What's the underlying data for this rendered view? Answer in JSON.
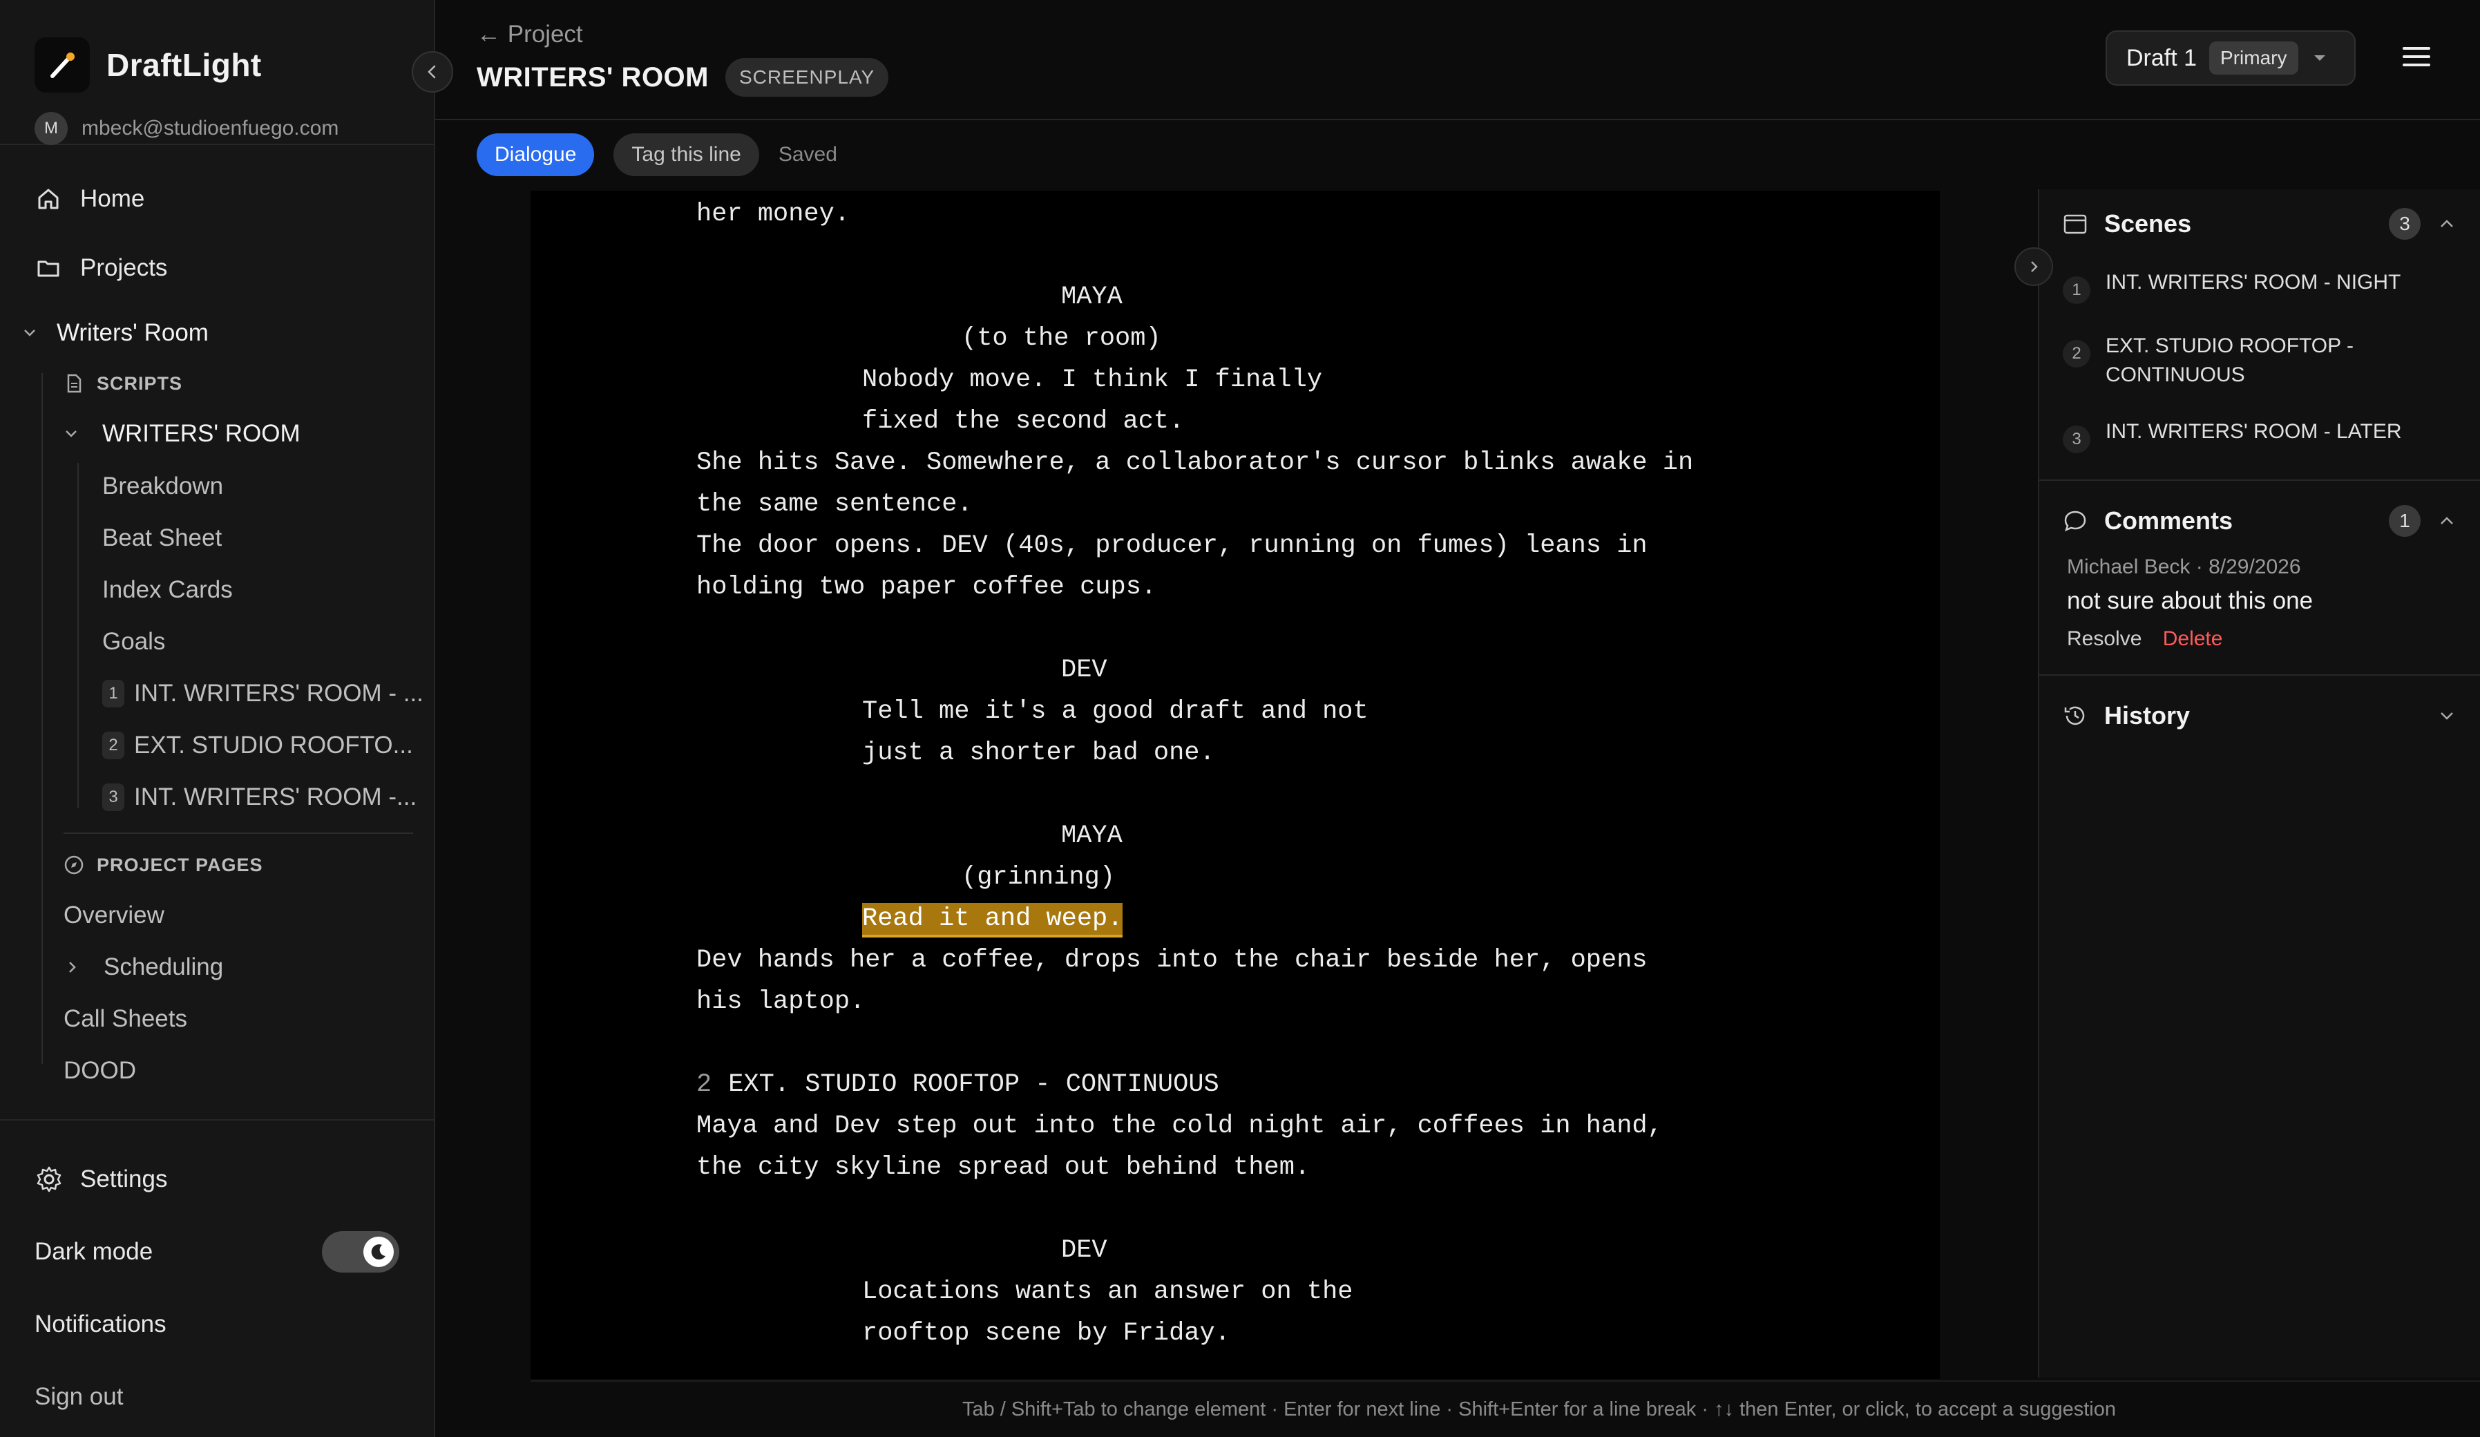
{
  "app": {
    "name": "DraftLight",
    "avatar_initial": "M",
    "email": "mbeck@studioenfuego.com"
  },
  "sidebar": {
    "home": "Home",
    "projects": "Projects",
    "project_name": "Writers' Room",
    "scripts_label": "SCRIPTS",
    "script_name": "WRITERS' ROOM",
    "script_children": [
      "Breakdown",
      "Beat Sheet",
      "Index Cards",
      "Goals"
    ],
    "scenes": [
      {
        "num": "1",
        "label": "INT. WRITERS' ROOM - ..."
      },
      {
        "num": "2",
        "label": "EXT. STUDIO ROOFTO..."
      },
      {
        "num": "3",
        "label": "INT. WRITERS' ROOM -..."
      }
    ],
    "project_pages_label": "PROJECT PAGES",
    "pages": [
      "Overview",
      "Scheduling",
      "Call Sheets",
      "DOOD"
    ],
    "settings": "Settings",
    "dark_mode": "Dark mode",
    "notifications": "Notifications",
    "sign_out": "Sign out"
  },
  "header": {
    "back": "← Project",
    "title": "WRITERS' ROOM",
    "badge": "SCREENPLAY",
    "draft": "Draft 1",
    "draft_badge": "Primary"
  },
  "toolbar": {
    "element": "Dialogue",
    "tag": "Tag this line",
    "status": "Saved"
  },
  "script": {
    "l01": "her money.",
    "l02": "",
    "l03": "MAYA",
    "l04": "(to the room)",
    "l05": "Nobody move. I think I finally",
    "l06": "fixed the second act.",
    "l07": "She hits Save. Somewhere, a collaborator's cursor blinks awake in",
    "l08": "the same sentence.",
    "l09": "The door opens. DEV (40s, producer, running on fumes) leans in",
    "l10": "holding two paper coffee cups.",
    "l11": "",
    "l12": "DEV",
    "l13": "Tell me it's a good draft and not",
    "l14": "just a shorter bad one.",
    "l15": "",
    "l16": "MAYA",
    "l17": "(grinning)",
    "l18": "Read it and weep.",
    "l19": "Dev hands her a coffee, drops into the chair beside her, opens",
    "l20": "his laptop.",
    "l21": "",
    "l22_num": "2",
    "l22": "EXT. STUDIO ROOFTOP - CONTINUOUS",
    "l23": "Maya and Dev step out into the cold night air, coffees in hand,",
    "l24": "the city skyline spread out behind them.",
    "l25": "",
    "l26": "DEV",
    "l27": "Locations wants an answer on the",
    "l28": "rooftop scene by Friday."
  },
  "hint": "Tab / Shift+Tab to change element · Enter for next line · Shift+Enter for a line break · ↑↓ then Enter, or click, to accept a suggestion",
  "panel": {
    "scenes_title": "Scenes",
    "scenes_count": "3",
    "scenes": [
      {
        "num": "1",
        "label": "INT. WRITERS' ROOM - NIGHT"
      },
      {
        "num": "2",
        "label": "EXT. STUDIO ROOFTOP - CONTINUOUS"
      },
      {
        "num": "3",
        "label": "INT. WRITERS' ROOM - LATER"
      }
    ],
    "comments_title": "Comments",
    "comments_count": "1",
    "comment": {
      "meta": "Michael Beck · 8/29/2026",
      "text": "not sure about this one",
      "resolve": "Resolve",
      "delete": "Delete"
    },
    "history_title": "History"
  },
  "colors": {
    "accent": "#2a6cf0",
    "highlight": "#a8780f",
    "danger": "#ff5a5a"
  }
}
